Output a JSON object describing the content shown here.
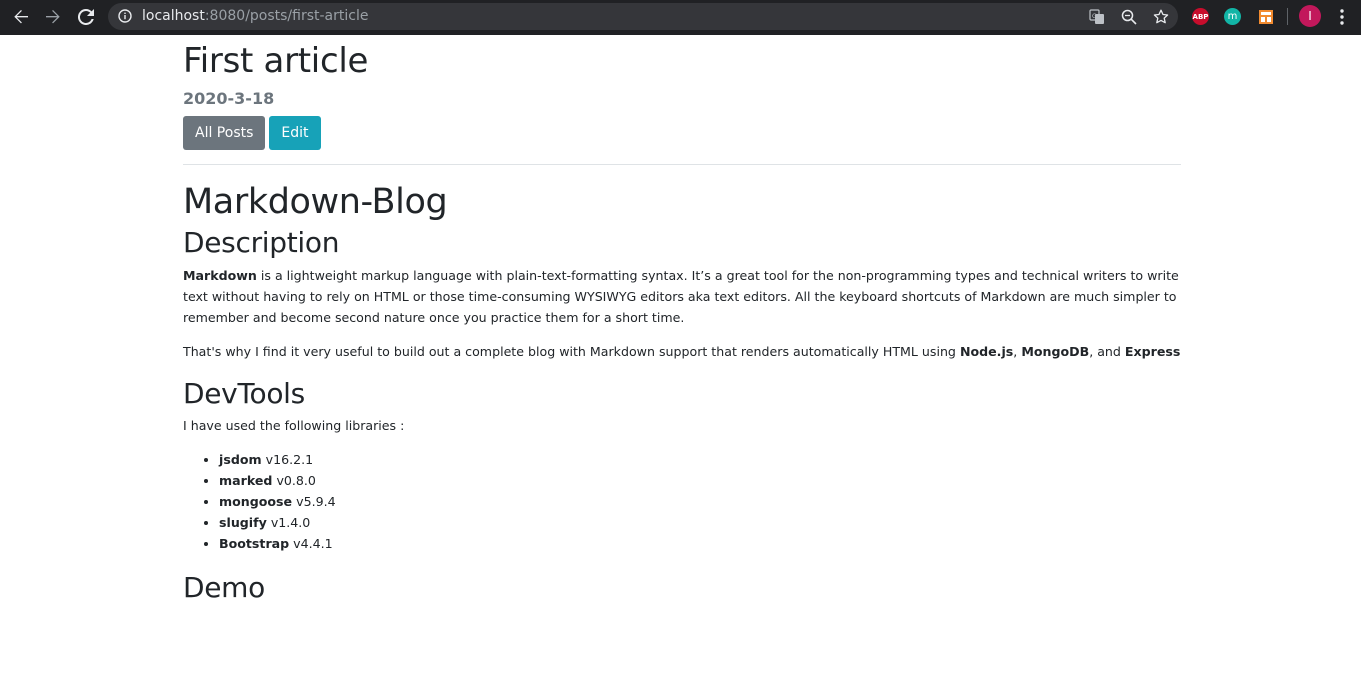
{
  "browser": {
    "url_host": "localhost",
    "url_rest": ":8080/posts/first-article",
    "profile_initial": "I",
    "extensions": [
      {
        "name": "adblock-plus-icon",
        "label": "ABP"
      },
      {
        "name": "m-extension-icon",
        "label": "m"
      },
      {
        "name": "grid-extension-icon",
        "label": ""
      }
    ]
  },
  "post": {
    "title": "First article",
    "date": "2020-3-18",
    "buttons": {
      "all_posts": "All Posts",
      "edit": "Edit"
    }
  },
  "markdown": {
    "h1": "Markdown-Blog",
    "description_heading": "Description",
    "p1": {
      "bold": "Markdown",
      "text": " is a lightweight markup language with plain-text-formatting syntax. It’s a great tool for the non-programming types and technical writers to write text without having to rely on HTML or those time-consuming WYSIWYG editors aka text editors. All the keyboard shortcuts of Markdown are much simpler to remember and become second nature once you practice them for a short time."
    },
    "p2": {
      "text1": "That's why I find it very useful to build out a complete blog with Markdown support that renders automatically HTML using ",
      "b1": "Node.js",
      "sep1": ", ",
      "b2": "MongoDB",
      "sep2": ", and ",
      "b3": "Express"
    },
    "devtools_heading": "DevTools",
    "devtools_intro": "I have used the following libraries :",
    "libraries": [
      {
        "name": "jsdom",
        "version": " v16.2.1"
      },
      {
        "name": "marked",
        "version": " v0.8.0"
      },
      {
        "name": "mongoose",
        "version": " v5.9.4"
      },
      {
        "name": "slugify",
        "version": " v1.4.0"
      },
      {
        "name": "Bootstrap",
        "version": " v4.4.1"
      }
    ],
    "demo_heading": "Demo"
  }
}
